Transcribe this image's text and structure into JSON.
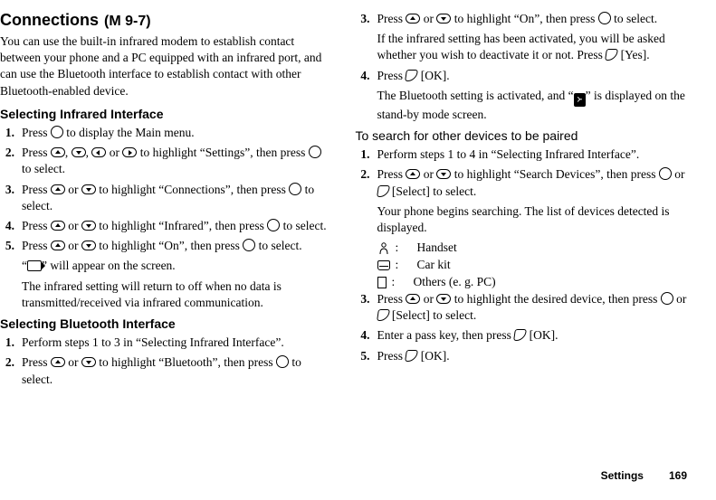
{
  "header": {
    "title": "Connections",
    "code": "(M 9-7)"
  },
  "intro": "You can use the built-in infrared modem to establish contact between your phone and a PC equipped with an infrared port, and can use the Bluetooth interface to establish contact with other Bluetooth-enabled device.",
  "left": {
    "sub1": "Selecting Infrared Interface",
    "s1": {
      "num": "1.",
      "text_a": "Press ",
      "text_b": " to display the Main menu."
    },
    "s2": {
      "num": "2.",
      "text_a": "Press ",
      "comma1": ", ",
      "comma2": ", ",
      "or": " or ",
      "text_b": " to highlight “Settings”, then press ",
      "text_c": " to select."
    },
    "s3": {
      "num": "3.",
      "text_a": "Press ",
      "or": " or ",
      "text_b": " to highlight “Connections”, then press ",
      "text_c": " to select."
    },
    "s4": {
      "num": "4.",
      "text_a": "Press ",
      "or": " or ",
      "text_b": " to highlight “Infrared”, then press ",
      "text_c": " to select."
    },
    "s5": {
      "num": "5.",
      "text_a": "Press ",
      "or": " or ",
      "text_b": " to highlight “On”, then press ",
      "text_c": " to select."
    },
    "s5note_a": "“",
    "s5note_b": "” will appear on the screen.",
    "s5note2": "The infrared setting will return to off when no data is transmitted/received via infrared communication.",
    "sub2": "Selecting Bluetooth Interface",
    "b1": {
      "num": "1.",
      "text": "Perform steps 1 to 3 in “Selecting Infrared Interface”."
    },
    "b2": {
      "num": "2.",
      "text_a": "Press ",
      "or": " or ",
      "text_b": " to highlight “Bluetooth”, then press ",
      "text_c": " to select."
    }
  },
  "right": {
    "r3": {
      "num": "3.",
      "text_a": "Press ",
      "or": " or ",
      "text_b": " to highlight “On”, then press ",
      "text_c": " to select."
    },
    "r3note": "If the infrared setting has been activated, you will be asked whether you wish to deactivate it or not. Press ",
    "r3note_b": " [Yes].",
    "r4": {
      "num": "4.",
      "text_a": "Press ",
      "text_b": " [OK]."
    },
    "r4note_a": "The Bluetooth setting is activated, and “",
    "r4note_b": "” is displayed on the stand-by mode screen.",
    "searchHdr": "To search for other devices to be paired",
    "p1": {
      "num": "1.",
      "text": "Perform steps 1 to 4 in “Selecting Infrared Interface”."
    },
    "p2": {
      "num": "2.",
      "text_a": "Press ",
      "or": " or ",
      "text_b": " to highlight “Search Devices”, then press ",
      "or2": " or ",
      "text_c": " [Select] to select."
    },
    "p2note": "Your phone begins searching. The list of devices detected is displayed.",
    "dev1": {
      "colon": ":",
      "label": "Handset"
    },
    "dev2": {
      "colon": ":",
      "label": "Car kit"
    },
    "dev3": {
      "colon": ":",
      "label": "Others (e. g. PC)"
    },
    "p3": {
      "num": "3.",
      "text_a": "Press ",
      "or": " or ",
      "text_b": " to highlight the desired device, then press ",
      "or2": " or ",
      "text_c": " [Select] to select."
    },
    "p4": {
      "num": "4.",
      "text_a": "Enter a pass key, then press ",
      "text_b": " [OK]."
    },
    "p5": {
      "num": "5.",
      "text_a": "Press ",
      "text_b": " [OK]."
    }
  },
  "footer": {
    "section": "Settings",
    "page": "169"
  }
}
